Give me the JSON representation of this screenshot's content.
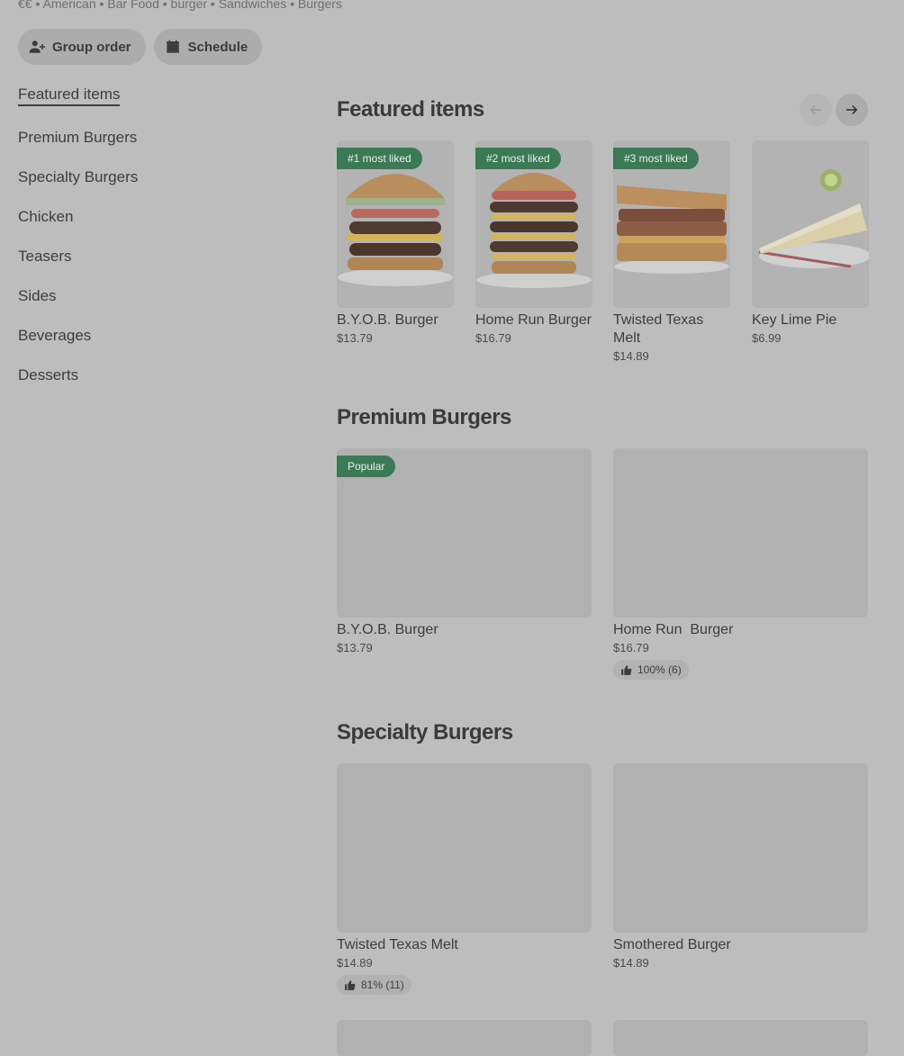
{
  "store": {
    "meta_line": "€€ • American • Bar Food • burger • Sandwiches • Burgers"
  },
  "actions": {
    "group_order": "Group order",
    "schedule": "Schedule"
  },
  "nav": {
    "items": [
      {
        "label": "Featured items",
        "active": true
      },
      {
        "label": "Premium Burgers"
      },
      {
        "label": "Specialty Burgers"
      },
      {
        "label": "Chicken"
      },
      {
        "label": "Teasers"
      },
      {
        "label": "Sides"
      },
      {
        "label": "Beverages"
      },
      {
        "label": "Desserts"
      }
    ]
  },
  "featured": {
    "title": "Featured items",
    "items": [
      {
        "badge": "#1 most liked",
        "name": "B.Y.O.B. Burger",
        "price": "$13.79"
      },
      {
        "badge": "#2 most liked",
        "name": "Home Run Burger",
        "price": "$16.79"
      },
      {
        "badge": "#3 most liked",
        "name": "Twisted Texas Melt",
        "price": "$14.89"
      },
      {
        "badge": "",
        "name": "Key Lime Pie",
        "price": "$6.99"
      }
    ]
  },
  "premium": {
    "title": "Premium Burgers",
    "items": [
      {
        "badge": "Popular",
        "name": "B.Y.O.B. Burger",
        "price": "$13.79",
        "rating": ""
      },
      {
        "badge": "",
        "name": "Home Run  Burger",
        "price": "$16.79",
        "rating": "100% (6)"
      }
    ]
  },
  "specialty": {
    "title": "Specialty Burgers",
    "items": [
      {
        "name": "Twisted Texas Melt",
        "price": "$14.89",
        "rating": "81% (11)"
      },
      {
        "name": "Smothered Burger",
        "price": "$14.89",
        "rating": ""
      }
    ]
  },
  "colors": {
    "badge_green": "#3b7a55",
    "overlay_gray": "#bdbdbd"
  }
}
